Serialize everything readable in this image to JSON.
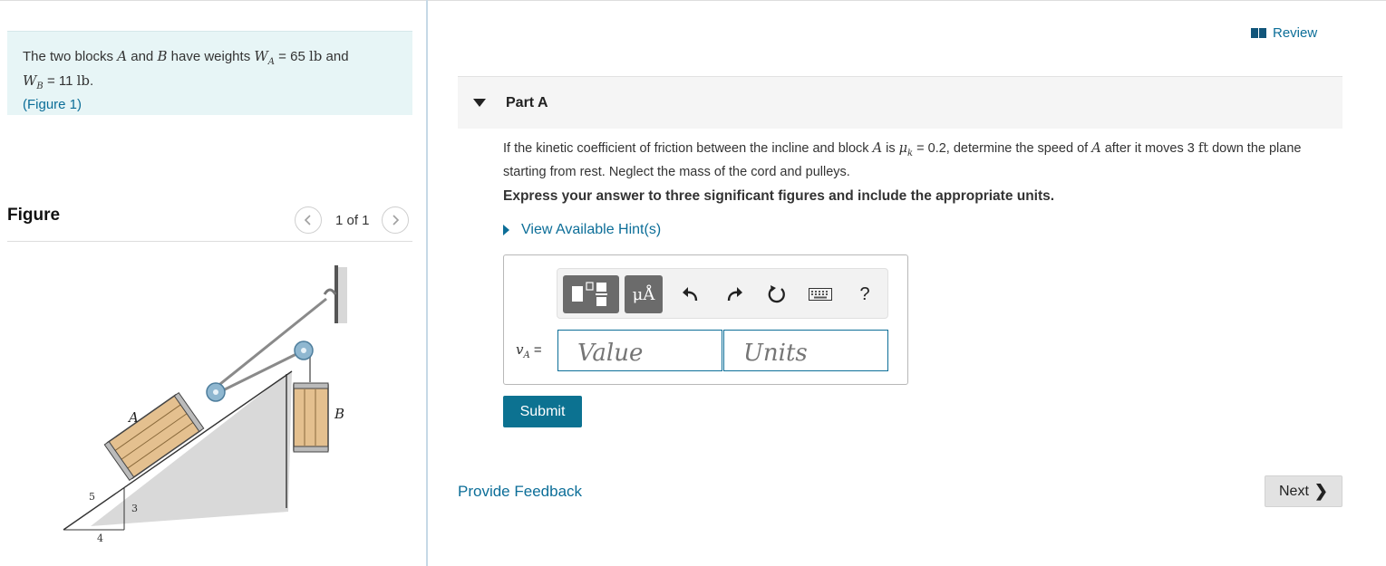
{
  "problem": {
    "text_pre": "The two blocks ",
    "block_a": "A",
    "text_and": " and ",
    "block_b": "B",
    "text_have": " have weights ",
    "wa_sym": "W",
    "wa_sub": "A",
    "wa_val": " = 65 ",
    "wa_unit": "lb",
    "text_and2": " and",
    "wb_sym": "W",
    "wb_sub": "B",
    "wb_val": " = 11 ",
    "wb_unit": "lb",
    "wb_end": ".",
    "figure_link": "(Figure 1)"
  },
  "figure": {
    "title": "Figure",
    "pager": "1 of 1",
    "prev_icon": "chevron-left-icon",
    "next_icon": "chevron-right-icon",
    "labels": {
      "a": "A",
      "b": "B",
      "five": "5",
      "three": "3",
      "four": "4"
    }
  },
  "review": {
    "label": "Review",
    "icon": "book-icon"
  },
  "part": {
    "title": "Part A"
  },
  "question": {
    "q1": "If the kinetic coefficient of friction between the incline and block ",
    "q_a": "A",
    "q2": " is ",
    "mu": "μ",
    "mu_sub": "k",
    "q3": " = 0.2, determine the speed of ",
    "q_a2": "A",
    "q4": " after it moves 3 ",
    "q_ft": "ft",
    "q5": " down the plane starting from rest. Neglect the mass of the cord and pulleys."
  },
  "instruction": "Express your answer to three significant figures and include the appropriate units.",
  "hints": {
    "label": "View Available Hint(s)"
  },
  "toolbar": {
    "templates_icon": "templates-icon",
    "units_label": "μÅ",
    "undo_icon": "undo-icon",
    "redo_icon": "redo-icon",
    "reset_icon": "reset-icon",
    "keyboard_icon": "keyboard-icon",
    "help_label": "?"
  },
  "answer": {
    "var_sym": "v",
    "var_sub": "A",
    "var_eq": " =",
    "value_placeholder": "Value",
    "units_placeholder": "Units"
  },
  "submit_label": "Submit",
  "feedback_label": "Provide Feedback",
  "next": {
    "label": "Next",
    "chevron": "❯"
  },
  "colors": {
    "accent": "#0c6e98",
    "problem_bg": "#e7f5f6",
    "submit_bg": "#0c7291"
  }
}
